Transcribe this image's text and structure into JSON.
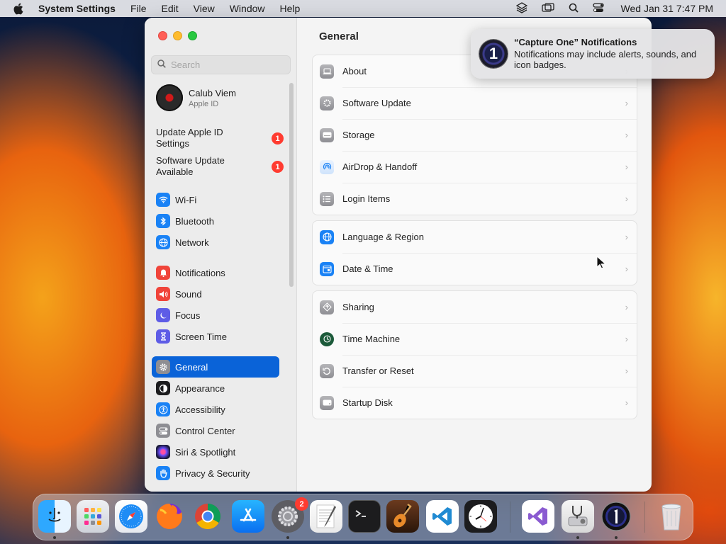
{
  "menubar": {
    "app_name": "System Settings",
    "menus": [
      "File",
      "Edit",
      "View",
      "Window",
      "Help"
    ],
    "clock": "Wed Jan 31  7:47 PM"
  },
  "sidebar": {
    "search_placeholder": "Search",
    "profile": {
      "name": "Calub Viem",
      "subtitle": "Apple ID"
    },
    "notices": [
      {
        "label": "Update Apple ID Settings",
        "badge": "1"
      },
      {
        "label": "Software Update Available",
        "badge": "1"
      }
    ],
    "items": [
      {
        "label": "Wi-Fi",
        "icon": "wifi-icon",
        "color": "#1a82f5"
      },
      {
        "label": "Bluetooth",
        "icon": "bluetooth-icon",
        "color": "#1a82f5"
      },
      {
        "label": "Network",
        "icon": "globe-icon",
        "color": "#1a82f5"
      },
      {
        "label": "Notifications",
        "icon": "bell-icon",
        "color": "#f0443a"
      },
      {
        "label": "Sound",
        "icon": "speaker-icon",
        "color": "#f0443a"
      },
      {
        "label": "Focus",
        "icon": "moon-icon",
        "color": "#5e5ce6"
      },
      {
        "label": "Screen Time",
        "icon": "hourglass-icon",
        "color": "#5e5ce6"
      },
      {
        "label": "General",
        "icon": "gear-icon",
        "color": "#8e8e93"
      },
      {
        "label": "Appearance",
        "icon": "appearance-icon",
        "color": "#1c1c1e"
      },
      {
        "label": "Accessibility",
        "icon": "accessibility-icon",
        "color": "#1a82f5"
      },
      {
        "label": "Control Center",
        "icon": "control-center-icon",
        "color": "#8e8e93"
      },
      {
        "label": "Siri & Spotlight",
        "icon": "siri-icon",
        "color": "#7a3ad6"
      },
      {
        "label": "Privacy & Security",
        "icon": "hand-icon",
        "color": "#1a82f5"
      }
    ]
  },
  "content": {
    "title": "General",
    "groups": [
      [
        {
          "label": "About",
          "icon": "laptop-icon"
        },
        {
          "label": "Software Update",
          "icon": "gear-badge-icon"
        },
        {
          "label": "Storage",
          "icon": "drive-icon"
        },
        {
          "label": "AirDrop & Handoff",
          "icon": "airdrop-icon"
        },
        {
          "label": "Login Items",
          "icon": "list-icon"
        }
      ],
      [
        {
          "label": "Language & Region",
          "icon": "globe-icon"
        },
        {
          "label": "Date & Time",
          "icon": "calendar-icon"
        }
      ],
      [
        {
          "label": "Sharing",
          "icon": "sharing-icon"
        },
        {
          "label": "Time Machine",
          "icon": "time-machine-icon"
        },
        {
          "label": "Transfer or Reset",
          "icon": "reset-icon"
        },
        {
          "label": "Startup Disk",
          "icon": "disk-icon"
        }
      ]
    ]
  },
  "notification": {
    "title": "“Capture One” Notifications",
    "body": "Notifications may include alerts, sounds, and icon badges."
  },
  "dock": {
    "settings_badge": "2",
    "apps": [
      "Finder",
      "Launchpad",
      "Safari",
      "Firefox",
      "Chrome",
      "App Store",
      "System Settings",
      "TextEdit",
      "Terminal",
      "GarageBand",
      "Visual Studio Code",
      "Clock",
      "Visual Studio",
      "Disk Utility",
      "Capture One",
      "Trash"
    ]
  }
}
